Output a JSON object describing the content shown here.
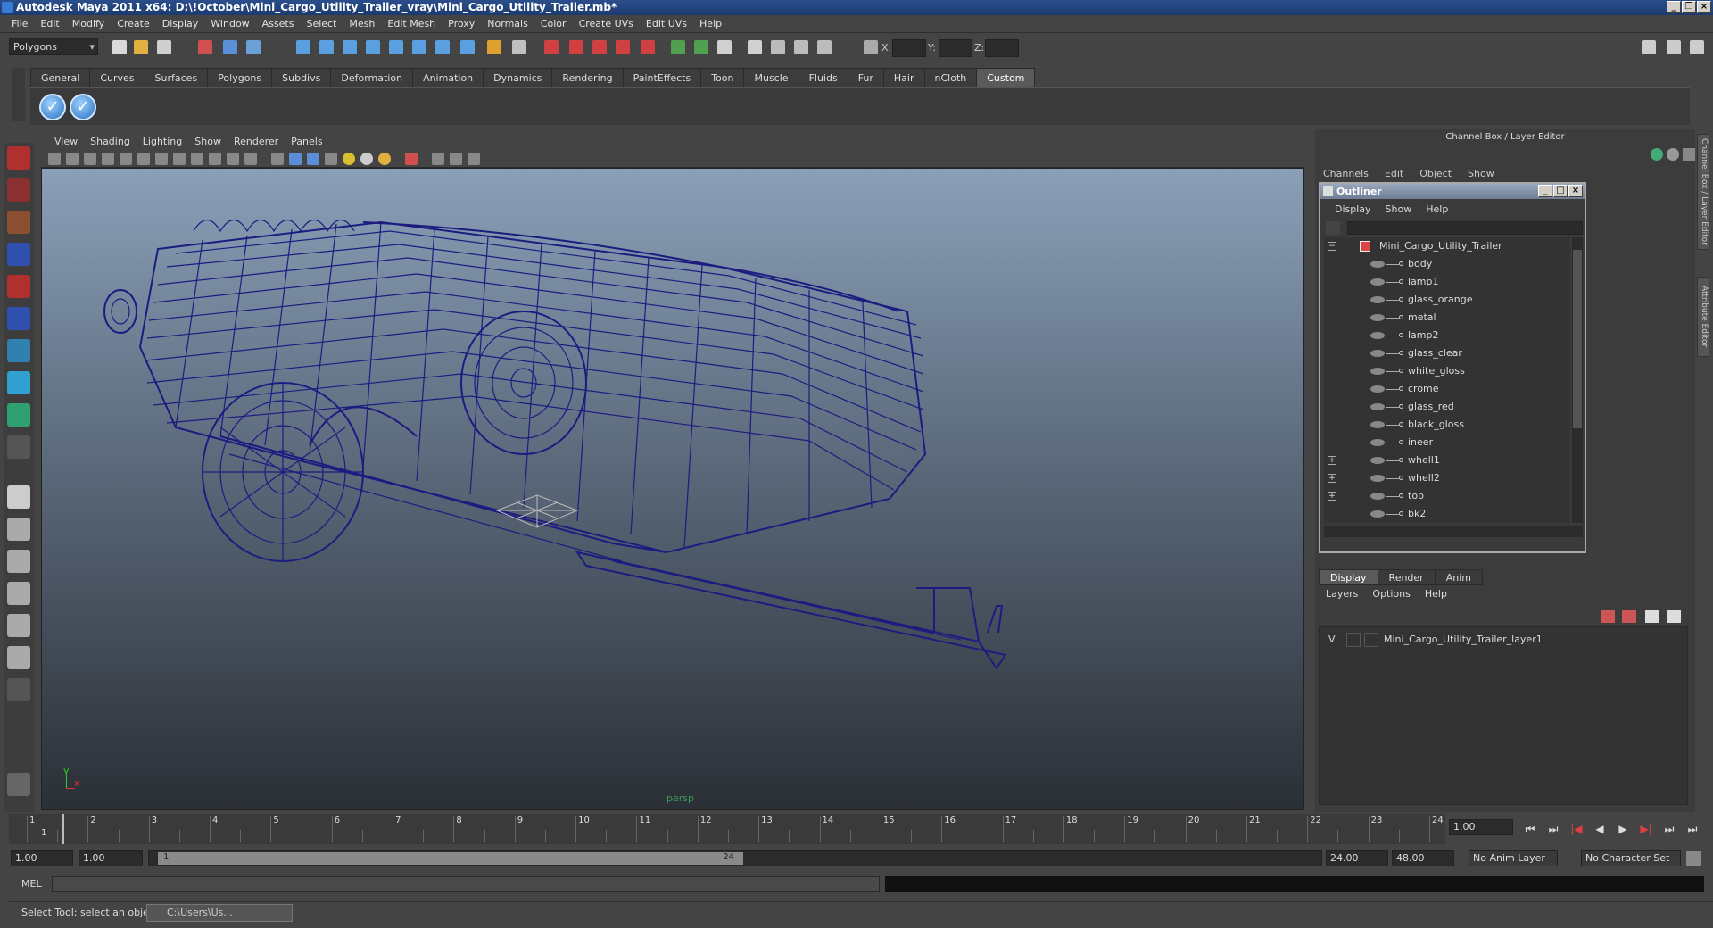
{
  "window": {
    "title": "Autodesk Maya 2011 x64: D:\\!October\\Mini_Cargo_Utility_Trailer_vray\\Mini_Cargo_Utility_Trailer.mb*"
  },
  "menubar": [
    "File",
    "Edit",
    "Modify",
    "Create",
    "Display",
    "Window",
    "Assets",
    "Select",
    "Mesh",
    "Edit Mesh",
    "Proxy",
    "Normals",
    "Color",
    "Create UVs",
    "Edit UVs",
    "Help"
  ],
  "statusline": {
    "mode": "Polygons",
    "x_label": "X:",
    "y_label": "Y:",
    "z_label": "Z:"
  },
  "shelf": {
    "tabs": [
      "General",
      "Curves",
      "Surfaces",
      "Polygons",
      "Subdivs",
      "Deformation",
      "Animation",
      "Dynamics",
      "Rendering",
      "PaintEffects",
      "Toon",
      "Muscle",
      "Fluids",
      "Fur",
      "Hair",
      "nCloth",
      "Custom"
    ],
    "active_tab": "Custom"
  },
  "viewport": {
    "menu": [
      "View",
      "Shading",
      "Lighting",
      "Show",
      "Renderer",
      "Panels"
    ],
    "camera": "persp",
    "axis": {
      "y": "y",
      "x": "x"
    },
    "wire_color": "#1a1a7a",
    "bg_top": "#8aa0b8",
    "bg_bottom": "#2b2f36"
  },
  "channel_box": {
    "title": "Channel Box / Layer Editor",
    "menu": [
      "Channels",
      "Edit",
      "Object",
      "Show"
    ],
    "side_tabs": [
      "Channel Box / Layer Editor",
      "Attribute Editor"
    ]
  },
  "outliner": {
    "title": "Outliner",
    "menu": [
      "Display",
      "Show",
      "Help"
    ],
    "items": [
      {
        "label": "Mini_Cargo_Utility_Trailer",
        "expander": "−",
        "root": true
      },
      {
        "label": "body",
        "expander": ""
      },
      {
        "label": "lamp1",
        "expander": ""
      },
      {
        "label": "glass_orange",
        "expander": ""
      },
      {
        "label": "metal",
        "expander": ""
      },
      {
        "label": "lamp2",
        "expander": ""
      },
      {
        "label": "glass_clear",
        "expander": ""
      },
      {
        "label": "white_gloss",
        "expander": ""
      },
      {
        "label": "crome",
        "expander": ""
      },
      {
        "label": "glass_red",
        "expander": ""
      },
      {
        "label": "black_gloss",
        "expander": ""
      },
      {
        "label": "ineer",
        "expander": ""
      },
      {
        "label": "whell1",
        "expander": "+"
      },
      {
        "label": "whell2",
        "expander": "+"
      },
      {
        "label": "top",
        "expander": "+"
      },
      {
        "label": "bk2",
        "expander": ""
      }
    ]
  },
  "layer_editor": {
    "tabs": [
      "Display",
      "Render",
      "Anim"
    ],
    "active_tab": "Display",
    "menu": [
      "Layers",
      "Options",
      "Help"
    ],
    "layers": [
      {
        "visible": "V",
        "name": "Mini_Cargo_Utility_Trailer_layer1"
      }
    ]
  },
  "timeline": {
    "ticks": [
      "1",
      "2",
      "3",
      "4",
      "5",
      "6",
      "7",
      "8",
      "9",
      "10",
      "11",
      "12",
      "13",
      "14",
      "15",
      "16",
      "17",
      "18",
      "19",
      "20",
      "21",
      "22",
      "23",
      "24"
    ],
    "current_frame_label": "1",
    "current_time": "1.00"
  },
  "range": {
    "start_time": "1.00",
    "playback_start": "1.00",
    "slider_start": "1",
    "slider_end": "24",
    "playback_end": "24.00",
    "end_time": "48.00",
    "anim_layer": "No Anim Layer",
    "character_set": "No Character Set"
  },
  "command_line": {
    "label": "MEL"
  },
  "help_line": {
    "text": "Select Tool: select an object",
    "task_label": "C:\\Users\\Us..."
  }
}
